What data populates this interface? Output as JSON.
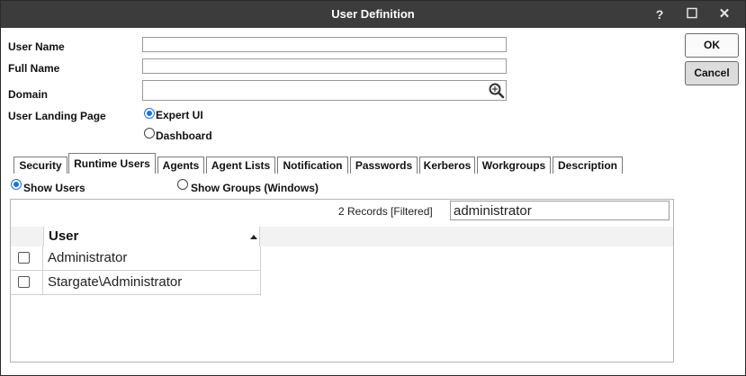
{
  "window": {
    "title": "User Definition",
    "help": "?",
    "maximize": "☐",
    "close": "✕"
  },
  "form": {
    "user_name_label": "User Name",
    "user_name_value": "",
    "full_name_label": "Full Name",
    "full_name_value": "",
    "domain_label": "Domain",
    "domain_value": "",
    "landing_label": "User Landing Page",
    "landing_options": [
      "Expert UI",
      "Dashboard"
    ],
    "landing_selected": "Expert UI"
  },
  "buttons": {
    "ok": "OK",
    "cancel": "Cancel"
  },
  "tabs": [
    "Security",
    "Runtime Users",
    "Agents",
    "Agent Lists",
    "Notification",
    "Passwords",
    "Kerberos",
    "Workgroups",
    "Description"
  ],
  "active_tab": "Runtime Users",
  "runtime": {
    "show_users": "Show Users",
    "show_groups": "Show Groups (Windows)",
    "selected": "Show Users",
    "records": "2 Records [Filtered]",
    "filter_value": "administrator",
    "column_user": "User",
    "rows": [
      "Administrator",
      "Stargate\\Administrator"
    ]
  },
  "colors": {
    "titlebar": "#3c3c3c",
    "accent": "#1a73e8"
  },
  "icons": {
    "domain_lookup": "search-icon",
    "sort": "sort-asc-icon"
  }
}
